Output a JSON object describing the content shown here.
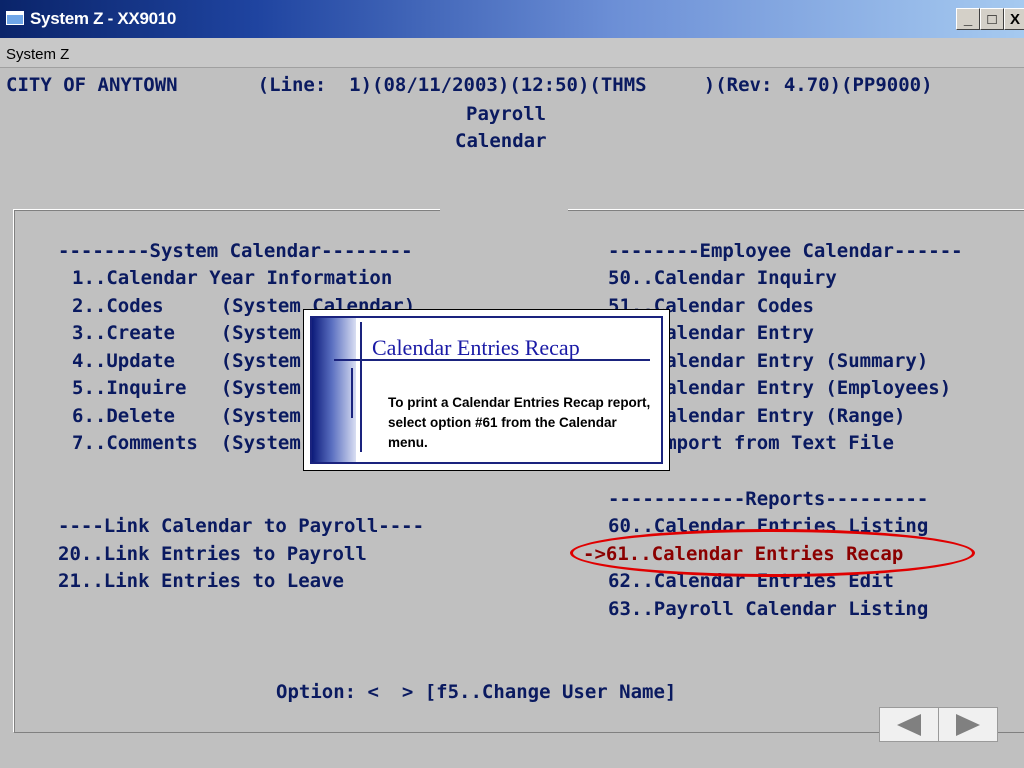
{
  "window": {
    "title": "System Z - XX9010",
    "min_glyph": "_",
    "max_glyph": "□",
    "close_glyph": "X"
  },
  "menu": {
    "items": [
      "System Z"
    ]
  },
  "terminal": {
    "header_line": "CITY OF ANYTOWN       (Line:  1)(08/11/2003)(12:50)(THMS     )(Rev: 4.70)(PP9000)",
    "module": "Payroll",
    "screen_title": "Calendar",
    "system_calendar": {
      "heading": "--------System Calendar--------",
      "items": [
        "1..Calendar Year Information",
        "2..Codes     (System Calendar)",
        "3..Create    (System Calendar)",
        "4..Update    (System Calendar)",
        "5..Inquire   (System Calendar)",
        "6..Delete    (System Calendar)",
        "7..Comments  (System Calendar)"
      ]
    },
    "employee_calendar": {
      "heading": "--------Employee Calendar------",
      "items": [
        "50..Calendar Inquiry",
        "51..Calendar Codes",
        "52..Calendar Entry",
        "53..Calendar Entry (Summary)",
        "54..Calendar Entry (Employees)",
        "55..Calendar Entry (Range)",
        "56..Import from Text File"
      ]
    },
    "link_calendar": {
      "heading": "----Link Calendar to Payroll----",
      "items": [
        "20..Link Entries to Payroll",
        "21..Link Entries to Leave"
      ]
    },
    "reports": {
      "heading": "------------Reports---------",
      "items": [
        "60..Calendar Entries Listing",
        "->61..Calendar Entries Recap",
        "62..Calendar Entries Edit",
        "63..Payroll Calendar Listing"
      ],
      "selected_index": 1
    },
    "option_prompt": "Option: <  > [f5..Change User Name]"
  },
  "callout": {
    "title": "Calendar Entries Recap",
    "body": "To print a Calendar Entries Recap report, select option #61 from the Calendar menu."
  },
  "colors": {
    "terminal_text": "#0a1a60",
    "selected_text": "#8b0000",
    "highlight_ring": "#e00000",
    "callout_title": "#1a1aa6"
  },
  "nav": {
    "prev_icon": "left-arrow-icon",
    "next_icon": "right-arrow-icon"
  }
}
